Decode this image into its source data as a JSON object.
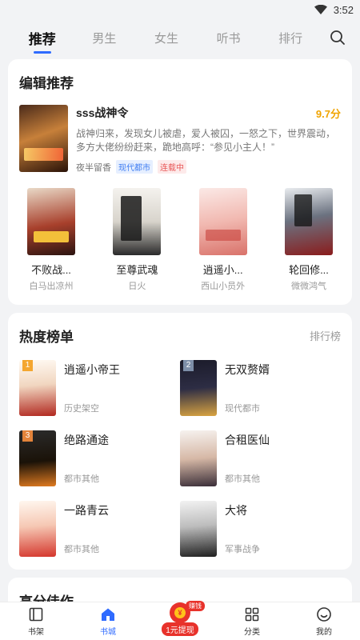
{
  "status": {
    "time": "3:52"
  },
  "top_tabs": [
    "推荐",
    "男生",
    "女生",
    "听书",
    "排行"
  ],
  "editor": {
    "title": "编辑推荐",
    "featured": {
      "name": "sss战神令",
      "score": "9.7分",
      "desc": "战神归来，发现女儿被虐，爱人被囚，一怒之下，世界震动，多方大佬纷纷赶来，跪地高呼：“参见小主人！”",
      "author": "夜半留香",
      "tags": [
        "现代都市",
        "连载中"
      ]
    },
    "books": [
      {
        "name": "不败战...",
        "author": "白马出凉州"
      },
      {
        "name": "至尊武魂",
        "author": "日火"
      },
      {
        "name": "逍遥小...",
        "author": "西山小员外"
      },
      {
        "name": "轮回修...",
        "author": "微微鸿气"
      }
    ]
  },
  "ranking": {
    "title": "热度榜单",
    "more": "排行榜",
    "items": [
      {
        "rank": "1",
        "name": "逍遥小帝王",
        "category": "历史架空"
      },
      {
        "rank": "2",
        "name": "无双赘婿",
        "category": "现代都市"
      },
      {
        "rank": "3",
        "name": "绝路通途",
        "category": "都市其他"
      },
      {
        "rank": "",
        "name": "合租医仙",
        "category": "都市其他"
      },
      {
        "rank": "",
        "name": "一路青云",
        "category": "都市其他"
      },
      {
        "rank": "",
        "name": "大将",
        "category": "军事战争"
      }
    ]
  },
  "high_score": {
    "title": "高分佳作"
  },
  "tabbar": {
    "shelf": "书架",
    "city": "书城",
    "withdraw": "1元提现",
    "earn": "赚钱",
    "category": "分类",
    "mine": "我的"
  }
}
